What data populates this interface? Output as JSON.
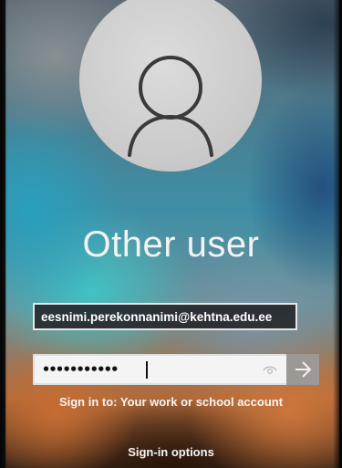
{
  "user": {
    "name": "Other user",
    "avatar_icon": "person-outline-icon"
  },
  "email_field": {
    "value": "eesnimi.perekonnanimi@kehtna.edu.ee"
  },
  "password_field": {
    "masked_value": "•••••••••••",
    "reveal_icon": "eye-icon",
    "submit_icon": "arrow-right-icon"
  },
  "sign_in_to": "Sign in to: Your work or school account",
  "sign_in_options": "Sign-in options",
  "colors": {
    "text": "#f5f5f5",
    "email_bg": "#232328",
    "password_bg": "#f4f4f4",
    "submit_bg": "#9c9893"
  }
}
